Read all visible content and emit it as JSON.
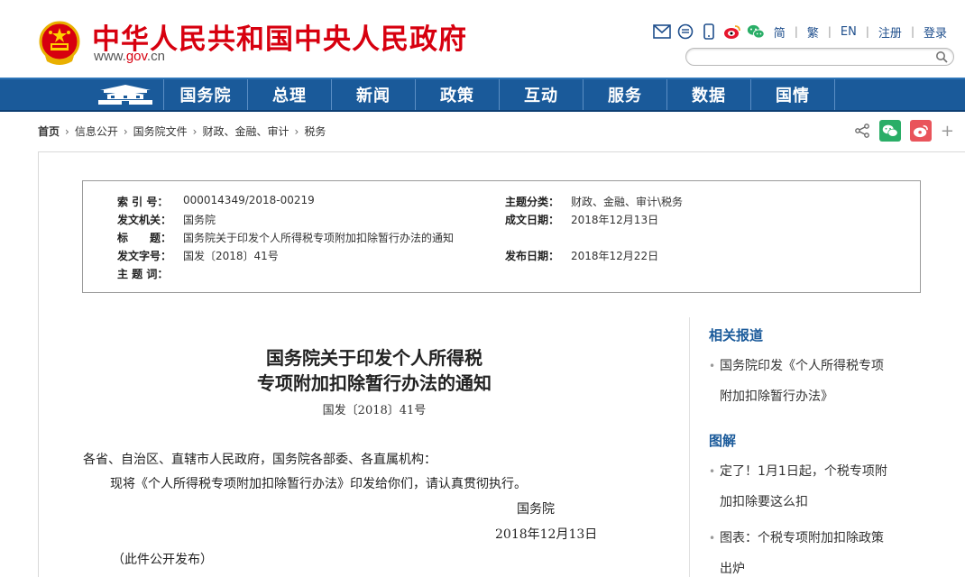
{
  "header": {
    "site_title": "中华人民共和国中央人民政府",
    "url_prefix": "www.",
    "url_gov": "gov",
    "url_suffix": ".cn",
    "links": [
      "简",
      "繁",
      "EN",
      "注册",
      "登录"
    ],
    "icons": [
      "mail-icon",
      "chat-bubble-icon",
      "mobile-icon",
      "weibo-icon",
      "wechat-icon"
    ],
    "search_placeholder": ""
  },
  "nav": {
    "items": [
      "国务院",
      "总理",
      "新闻",
      "政策",
      "互动",
      "服务",
      "数据",
      "国情"
    ]
  },
  "breadcrumb": [
    "首页",
    "信息公开",
    "国务院文件",
    "财政、金融、审计",
    "税务"
  ],
  "meta": {
    "index_label": "索 引 号：",
    "index_value": "000014349/2018-00219",
    "category_label": "主题分类：",
    "category_value": "财政、金融、审计\\税务",
    "issuer_label": "发文机关：",
    "issuer_value": "国务院",
    "created_label": "成文日期：",
    "created_value": "2018年12月13日",
    "title_label": "标　　题：",
    "title_value": "国务院关于印发个人所得税专项附加扣除暂行办法的通知",
    "docno_label": "发文字号：",
    "docno_value": "国发〔2018〕41号",
    "published_label": "发布日期：",
    "published_value": "2018年12月22日",
    "keywords_label": "主 题 词：",
    "keywords_value": ""
  },
  "article": {
    "title_line1": "国务院关于印发个人所得税",
    "title_line2": "专项附加扣除暂行办法的通知",
    "doc_no": "国发〔2018〕41号",
    "salutation": "各省、自治区、直辖市人民政府，国务院各部委、各直属机构：",
    "body": "现将《个人所得税专项附加扣除暂行办法》印发给你们，请认真贯彻执行。",
    "signer": "国务院",
    "date": "2018年12月13日",
    "note": "（此件公开发布）"
  },
  "sidebar": {
    "related_title": "相关报道",
    "related_items": [
      {
        "line1": "国务院印发《个人所得税专项",
        "line2": "附加扣除暂行办法》"
      }
    ],
    "graphic_title": "图解",
    "graphic_items": [
      {
        "line1": "定了！1月1日起，个税专项附",
        "line2": "加扣除要这么扣"
      },
      {
        "line1": "图表：个税专项附加扣除政策",
        "line2": "出炉"
      }
    ]
  },
  "colors": {
    "brand_red": "#d7000f",
    "nav_blue": "#1a5a9a",
    "link_blue": "#1e4e8c"
  }
}
